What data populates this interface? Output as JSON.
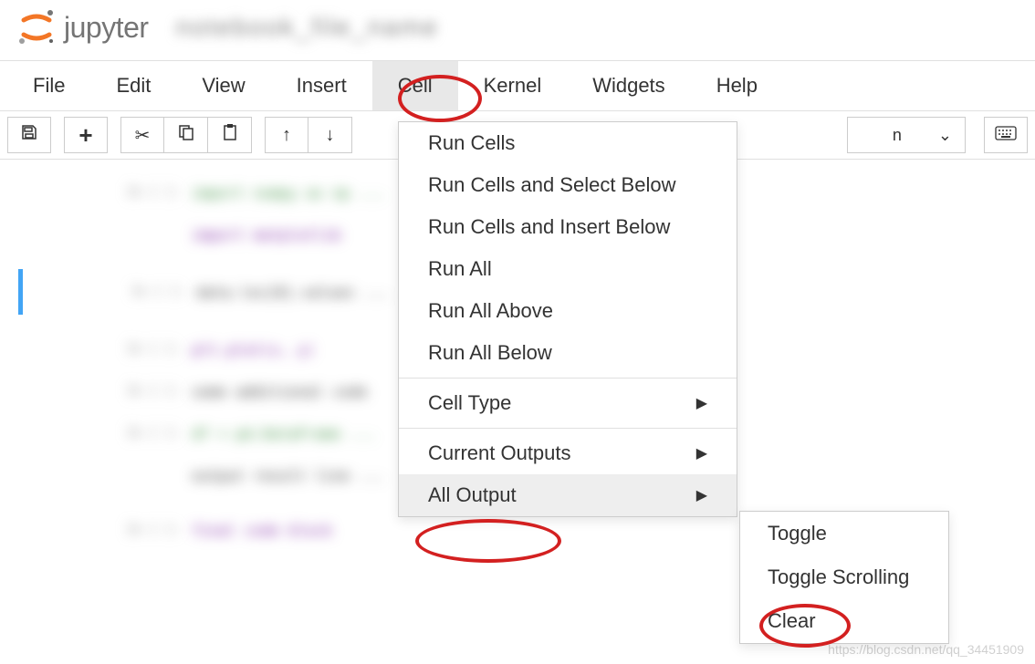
{
  "header": {
    "logo_text": "jupyter",
    "notebook_name": "notebook_file_name"
  },
  "menubar": {
    "items": [
      "File",
      "Edit",
      "View",
      "Insert",
      "Cell",
      "Kernel",
      "Widgets",
      "Help"
    ],
    "active_index": 4
  },
  "toolbar": {
    "kernel_select_suffix": "n"
  },
  "dropdown": {
    "items": [
      {
        "label": "Run Cells",
        "sep": false,
        "sub": false
      },
      {
        "label": "Run Cells and Select Below",
        "sep": false,
        "sub": false
      },
      {
        "label": "Run Cells and Insert Below",
        "sep": false,
        "sub": false
      },
      {
        "label": "Run All",
        "sep": false,
        "sub": false
      },
      {
        "label": "Run All Above",
        "sep": false,
        "sub": false
      },
      {
        "label": "Run All Below",
        "sep": true,
        "sub": false
      },
      {
        "label": "Cell Type",
        "sep": true,
        "sub": true
      },
      {
        "label": "Current Outputs",
        "sep": false,
        "sub": true
      },
      {
        "label": "All Output",
        "sep": false,
        "sub": true,
        "hover": true
      }
    ]
  },
  "submenu": {
    "items": [
      "Toggle",
      "Toggle Scrolling",
      "Clear"
    ]
  },
  "watermark": "https://blog.csdn.net/qq_34451909"
}
